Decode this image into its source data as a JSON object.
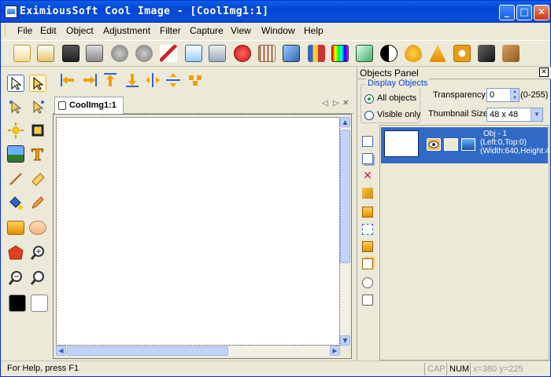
{
  "window": {
    "title": "EximiousSoft Cool Image - [CoolImg1:1]",
    "minimize": "_",
    "maximize": "□",
    "close": "✕"
  },
  "menu": [
    "File",
    "Edit",
    "Object",
    "Adjustment",
    "Filter",
    "Capture",
    "View",
    "Window",
    "Help"
  ],
  "toolbar_icons": [
    "new-file-icon",
    "open-file-icon",
    "save-icon",
    "print-icon",
    "undo-icon",
    "redo-icon",
    "cut-icon",
    "copy-icon",
    "paste-icon",
    "delete-icon",
    "grid-icon",
    "image-icon",
    "chart-icon",
    "color-palette-icon",
    "transform-icon",
    "contrast-icon",
    "drop-icon",
    "warning-icon",
    "ring-icon",
    "cube-icon",
    "puzzle-icon"
  ],
  "left_tool_icons": [
    "select-arrow-icon",
    "select-frame-icon",
    "lasso-icon",
    "magic-select-icon",
    "sun-icon",
    "crop-icon",
    "picture-icon",
    "text-icon",
    "line-icon",
    "eraser-icon",
    "fill-icon",
    "pencil-icon",
    "rectangle-icon",
    "ellipse-icon",
    "polygon-icon",
    "zoom-in-icon",
    "zoom-out-icon",
    "zoom-icon",
    "foreground-color-icon",
    "background-color-icon"
  ],
  "align_icons": [
    "align-left-icon",
    "align-right-icon",
    "align-top-icon",
    "align-bottom-icon",
    "center-horizontal-icon",
    "center-vertical-icon",
    "distribute-icon"
  ],
  "document": {
    "tab_label": "CoolImg1:1",
    "nav_prev": "◁",
    "nav_next": "▷",
    "nav_close": "✕"
  },
  "objects_panel": {
    "title": "Objects Panel",
    "close": "✕",
    "display_group_title": "Display Objects",
    "all_objects_label": "All objects",
    "visible_only_label": "Visible only",
    "display_selected": "All objects",
    "transparency_label": "Transparency:",
    "transparency_value": "0",
    "transparency_range": "(0-255)",
    "thumbnail_size_label": "Thumbnail Size:",
    "thumbnail_size_value": "48 x 48",
    "tool_icons": [
      "new-object-icon",
      "duplicate-icon",
      "delete-object-icon",
      "scissors-icon",
      "bring-front-icon",
      "send-back-icon",
      "move-up-icon",
      "move-down-icon",
      "rotate-icon",
      "properties-icon"
    ],
    "objects": [
      {
        "name": "Obj - 1",
        "position": "(Left:0,Top:0)",
        "size": "(Width:640,Height:4"
      }
    ]
  },
  "status": {
    "help_text": "For Help, press F1",
    "cap": "CAP",
    "num": "NUM",
    "coords": "x=380 y=225"
  }
}
